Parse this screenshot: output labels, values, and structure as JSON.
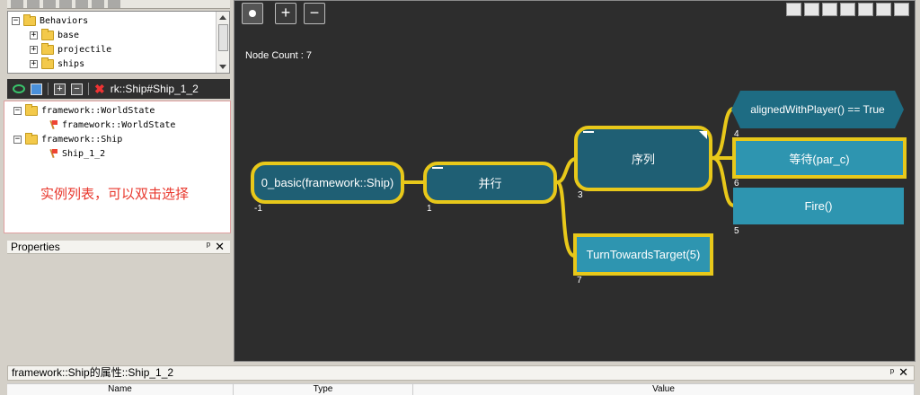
{
  "behaviors_tree": {
    "root": "Behaviors",
    "items": [
      {
        "label": "base"
      },
      {
        "label": "projectile"
      },
      {
        "label": "ships"
      }
    ]
  },
  "instance_toolbar": {
    "path": "rk::Ship#Ship_1_2"
  },
  "instance_tree": {
    "nodes": [
      {
        "label": "framework::WorldState"
      },
      {
        "label": "framework::WorldState"
      },
      {
        "label": "framework::Ship"
      },
      {
        "label": "Ship_1_2"
      }
    ],
    "hint": "实例列表，可以双击选择"
  },
  "properties_panel": {
    "title": "Properties",
    "pin": "ᵖ",
    "close": "✕"
  },
  "canvas": {
    "node_count": "Node Count : 7",
    "nodes": {
      "root": {
        "label": "0_basic(framework::Ship)",
        "index": "-1"
      },
      "parallel": {
        "label": "并行",
        "index": "1"
      },
      "sequence": {
        "label": "序列",
        "index": "3"
      },
      "turn": {
        "label": "TurnTowardsTarget(5)",
        "index": "7"
      },
      "condition": {
        "label": "alignedWithPlayer() == True",
        "index": "4"
      },
      "wait": {
        "label": "等待(par_c)",
        "index": "6"
      },
      "fire": {
        "label": "Fire()",
        "index": "5"
      }
    },
    "colors": {
      "link": "#e8c81a",
      "node_dark": "#1f5f74",
      "node_action": "#2e95b0"
    }
  },
  "bottom_panel": {
    "title": "framework::Ship的属性::Ship_1_2",
    "columns": [
      "Name",
      "Type",
      "Value"
    ]
  }
}
